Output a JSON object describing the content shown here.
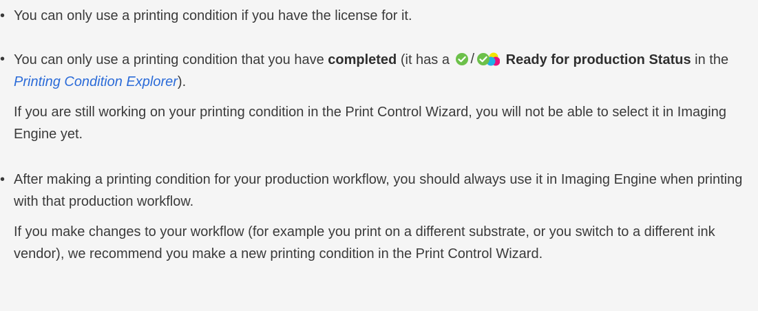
{
  "bullet_glyph": "•",
  "notes": [
    {
      "text": "You can only use a printing condition if you have the license for it."
    },
    {
      "prefix": "You can only use a printing condition that you have ",
      "bold1": "completed",
      "mid1": " (it has a ",
      "slash": "/",
      "bold2": " Ready for production Status",
      "mid2": " in the ",
      "link": "Printing Condition Explorer",
      "suffix": ").",
      "followup": "If you are still working on your printing condition in the Print Control Wizard, you will not be able to select it in Imaging Engine yet.",
      "icons": [
        "check-circle-green-icon",
        "check-circle-multicolor-icon"
      ]
    },
    {
      "text": "After making a printing condition for your production workflow, you should always use it in Imaging Engine when printing with that production workflow.",
      "followup": "If you make changes to your workflow (for example you print on a different substrate, or you switch to a different ink vendor), we recommend you make a new printing condition in the Print Control Wizard."
    }
  ],
  "colors": {
    "text": "#3a3a3a",
    "link": "#2b6bd8",
    "check_green": "#6cc04a",
    "background": "#f5f5f5"
  }
}
